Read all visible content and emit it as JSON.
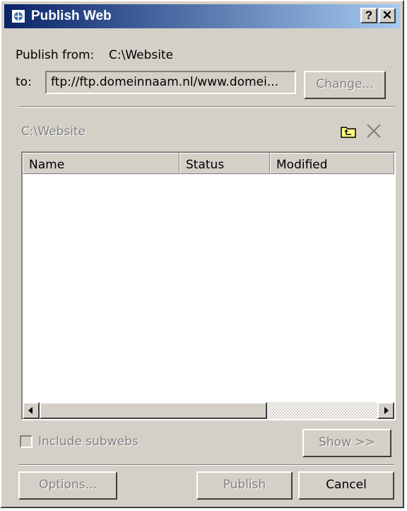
{
  "window": {
    "title": "Publish Web",
    "help_button": "?",
    "close_button": "✕"
  },
  "publish": {
    "from_label": "Publish from:",
    "from_value": "C:\\Website",
    "to_label": "to:",
    "to_value": "ftp://ftp.domeinnaam.nl/www.domei...",
    "change_button": "Change..."
  },
  "browser": {
    "path_label": "C:\\Website",
    "up_folder_icon": "folder-up-icon",
    "delete_icon": "delete-x-icon",
    "columns": [
      "Name",
      "Status",
      "Modified"
    ]
  },
  "options": {
    "include_subwebs_label": "Include subwebs",
    "include_subwebs_checked": false,
    "show_button": "Show >>"
  },
  "footer": {
    "options_button": "Options...",
    "publish_button": "Publish",
    "cancel_button": "Cancel"
  }
}
